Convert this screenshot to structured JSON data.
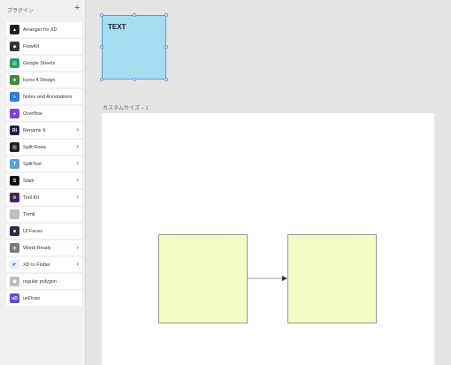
{
  "sidebar": {
    "header": "プラグイン",
    "add_label": "+",
    "plugins": [
      {
        "label": "Arranger for XD",
        "icon": "arranger-icon",
        "chevron": false
      },
      {
        "label": "FlowKit",
        "icon": "flowkit-icon",
        "chevron": false
      },
      {
        "label": "Google Sheets",
        "icon": "google-sheets-icon",
        "chevron": false
      },
      {
        "label": "Icons 4 Design",
        "icon": "icons4design-icon",
        "chevron": false
      },
      {
        "label": "Notes and Annotations",
        "icon": "notes-icon",
        "chevron": false
      },
      {
        "label": "Overflow",
        "icon": "overflow-icon",
        "chevron": false
      },
      {
        "label": "Rename It",
        "icon": "rename-it-icon",
        "chevron": true
      },
      {
        "label": "Split Rows",
        "icon": "split-rows-icon",
        "chevron": true
      },
      {
        "label": "SplitText",
        "icon": "splittext-icon",
        "chevron": true
      },
      {
        "label": "Stark",
        "icon": "stark-icon",
        "chevron": true
      },
      {
        "label": "Tool Kit",
        "icon": "toolkit-icon",
        "chevron": true
      },
      {
        "label": "Trimit",
        "icon": "trimit-icon",
        "chevron": false
      },
      {
        "label": "UI Faces",
        "icon": "ui-faces-icon",
        "chevron": false
      },
      {
        "label": "World Ready",
        "icon": "world-ready-icon",
        "chevron": true
      },
      {
        "label": "XD to Flutter",
        "icon": "flutter-icon",
        "chevron": true
      },
      {
        "label": "regular polygon",
        "icon": "polygon-icon",
        "chevron": false
      },
      {
        "label": "unDraw",
        "icon": "undraw-icon",
        "chevron": false
      }
    ]
  },
  "canvas": {
    "selected_text": "TEXT",
    "artboard_label": "カスタムサイズ – 1"
  }
}
